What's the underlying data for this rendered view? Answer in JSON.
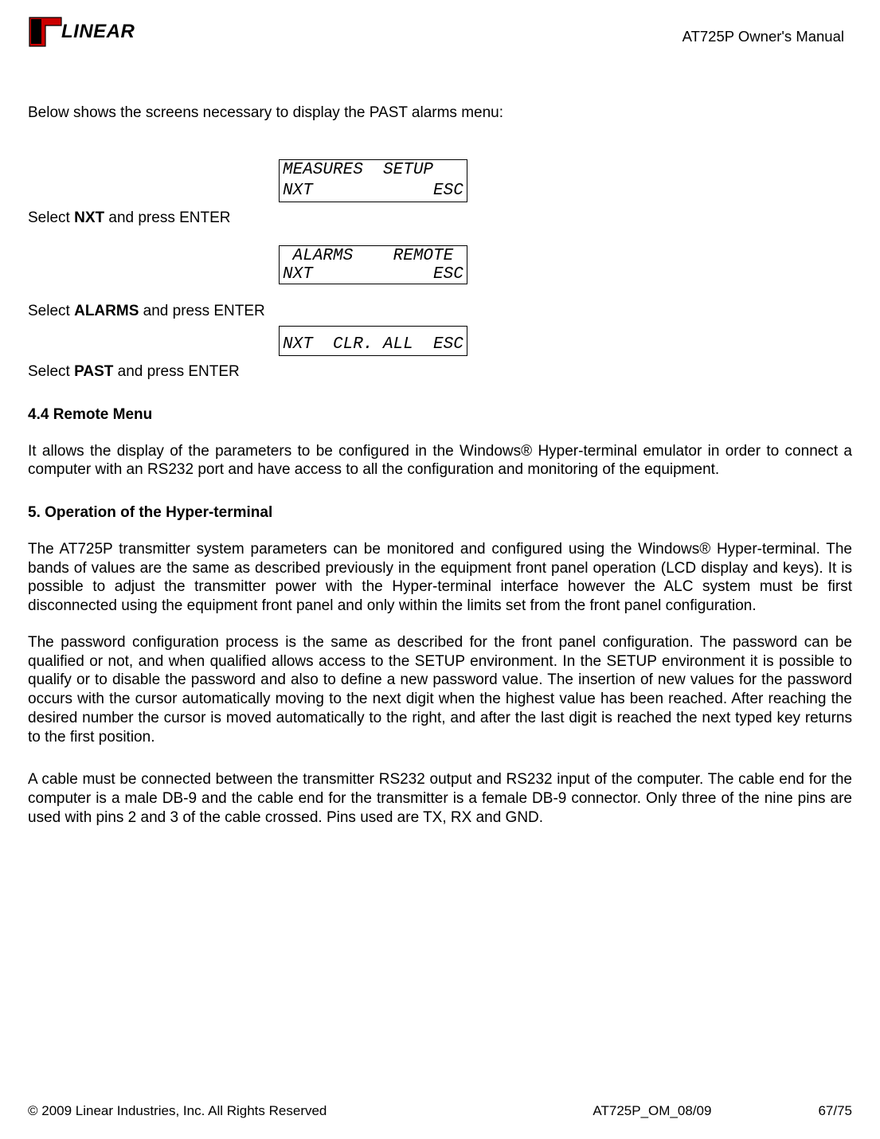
{
  "header": {
    "brand": "LINEAR",
    "docTitle": "AT725P Owner's Manual"
  },
  "intro": "Below shows the screens necessary to display the PAST alarms menu:",
  "lcd1": {
    "line1": "MEASURES  SETUP",
    "line2": "NXT            ESC"
  },
  "step1": {
    "pre": "Select ",
    "bold": "NXT",
    "post": " and press ENTER"
  },
  "lcd2": {
    "line1": "ALARMS    REMOTE",
    "line2": "NXT            ESC"
  },
  "step2": {
    "pre": "Select ",
    "bold": "ALARMS",
    "post": " and press ENTER"
  },
  "lcd3": {
    "line1": "NXT  CLR. ALL  ESC"
  },
  "step3": {
    "pre": "Select ",
    "bold": "PAST",
    "post": " and press ENTER"
  },
  "section44": {
    "heading": "4.4 Remote Menu",
    "p1": "It allows the display of the parameters to be configured in the Windows® Hyper-terminal emulator in order to connect a computer with an RS232 port and have access to all the configuration and monitoring of the equipment."
  },
  "section5": {
    "heading": "5. Operation of the Hyper-terminal",
    "p1": "The AT725P transmitter system parameters can be monitored and configured using the Windows® Hyper-terminal. The bands of values are the same as described previously in the equipment front panel operation (LCD display and keys). It is possible to adjust the transmitter power with the Hyper-terminal interface however the ALC system must be first disconnected using the equipment front panel and only within the limits set from the front panel configuration.",
    "p2": "The password configuration process is the same as described for the front panel configuration. The password can be qualified or not, and when qualified allows access to the SETUP environment. In the SETUP environment it is possible to qualify or to disable the password and also to define a new password value. The insertion of new values for the password occurs with the cursor automatically moving to the next digit when the highest value has been reached. After reaching the desired number the cursor is moved automatically to the right, and after the last digit is reached the next typed key returns to the first position.",
    "p3": "A cable must be connected between the transmitter RS232 output and RS232 input of the computer. The cable end for the computer is a male DB-9 and the cable end for the transmitter is a female DB-9 connector. Only three of the nine pins are used with pins 2 and 3 of the cable crossed. Pins used are TX, RX and GND."
  },
  "footer": {
    "left": "© 2009 Linear Industries, Inc.  All Rights Reserved",
    "center": "AT725P_OM_08/09",
    "right": "67/75"
  }
}
